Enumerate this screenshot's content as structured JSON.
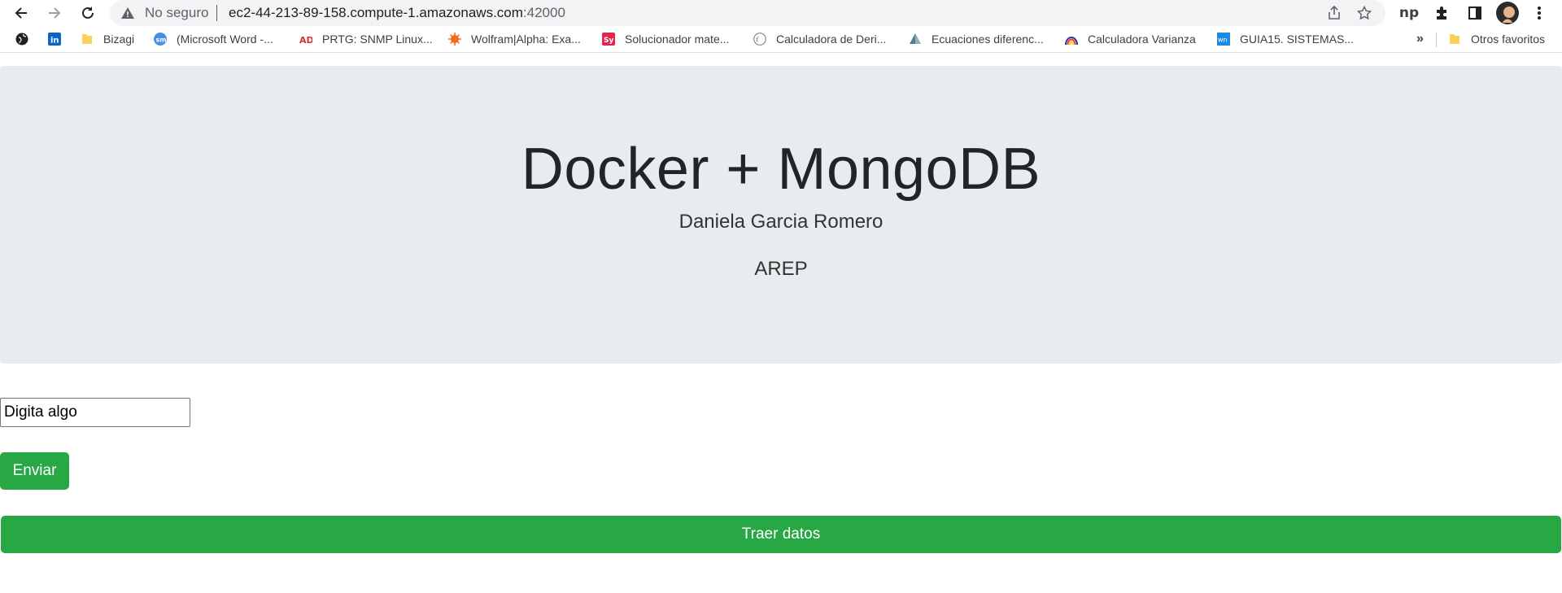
{
  "browser": {
    "security_label": "No seguro",
    "url_host": "ec2-44-213-89-158.compute-1.amazonaws.com",
    "url_port": ":42000",
    "bookmarks": [
      {
        "label": "",
        "icon": "globe-icon",
        "color": "#202124"
      },
      {
        "label": "",
        "icon": "linkedin-icon",
        "color": "#0a66c2"
      },
      {
        "label": "Bizagi",
        "icon": "folder-icon",
        "color": "#f9d25b"
      },
      {
        "label": "(Microsoft Word -...",
        "icon": "sm-icon",
        "color": "#4a8fe7"
      },
      {
        "label": "PRTG: SNMP Linux...",
        "icon": "adi-icon",
        "color": "#d0312d"
      },
      {
        "label": "Wolfram|Alpha: Exa...",
        "icon": "wolfram-icon",
        "color": "#f26a1b"
      },
      {
        "label": "Solucionador mate...",
        "icon": "symbolab-icon",
        "color": "#e2264d"
      },
      {
        "label": "Calculadora de Deri...",
        "icon": "derivative-icon",
        "color": "#8a8a8a"
      },
      {
        "label": "Ecuaciones diferenc...",
        "icon": "pyramid-icon",
        "color": "#5a7b8c"
      },
      {
        "label": "Calculadora Varianza",
        "icon": "rainbow-icon",
        "color": "#e53935"
      },
      {
        "label": "GUIA15. SISTEMAS...",
        "icon": "wn-icon",
        "color": "#1e88e5"
      }
    ],
    "overflow_label": "»",
    "other_favorites": "Otros favoritos"
  },
  "page": {
    "title": "Docker + MongoDB",
    "author": "Daniela Garcia Romero",
    "course": "AREP",
    "input_value": "Digita algo",
    "send_label": "Enviar",
    "fetch_label": "Traer datos"
  },
  "colors": {
    "accent": "#28a745",
    "jumbotron": "#e9ecef"
  }
}
